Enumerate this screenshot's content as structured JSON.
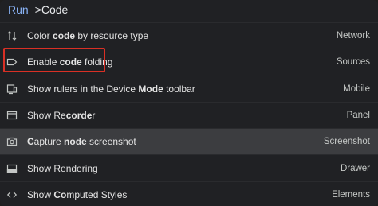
{
  "input": {
    "prefix": "Run",
    "query": ">Code"
  },
  "items": [
    {
      "pre": "Color ",
      "bold": "code",
      "post": " by resource type",
      "category": "Network",
      "icon": "sort-arrows-icon"
    },
    {
      "pre": "Enable ",
      "bold": "code",
      "post": " folding",
      "category": "Sources",
      "icon": "tag-icon"
    },
    {
      "pre": "Show rulers in the Device ",
      "bold": "Mode",
      "post": " toolbar",
      "category": "Mobile",
      "icon": "device-icon"
    },
    {
      "pre": "Show Re",
      "bold": "corde",
      "post": "r",
      "category": "Panel",
      "icon": "panel-icon"
    },
    {
      "pre": "",
      "bold": "C",
      "post": "apture ",
      "bold2": "node",
      "post2": " screenshot",
      "category": "Screenshot",
      "icon": "camera-icon"
    },
    {
      "pre": "Show Rendering",
      "bold": "",
      "post": "",
      "category": "Drawer",
      "icon": "drawer-icon"
    },
    {
      "pre": "Show ",
      "bold": "Co",
      "post": "mputed Styles",
      "category": "Elements",
      "icon": "code-brackets-icon"
    }
  ]
}
